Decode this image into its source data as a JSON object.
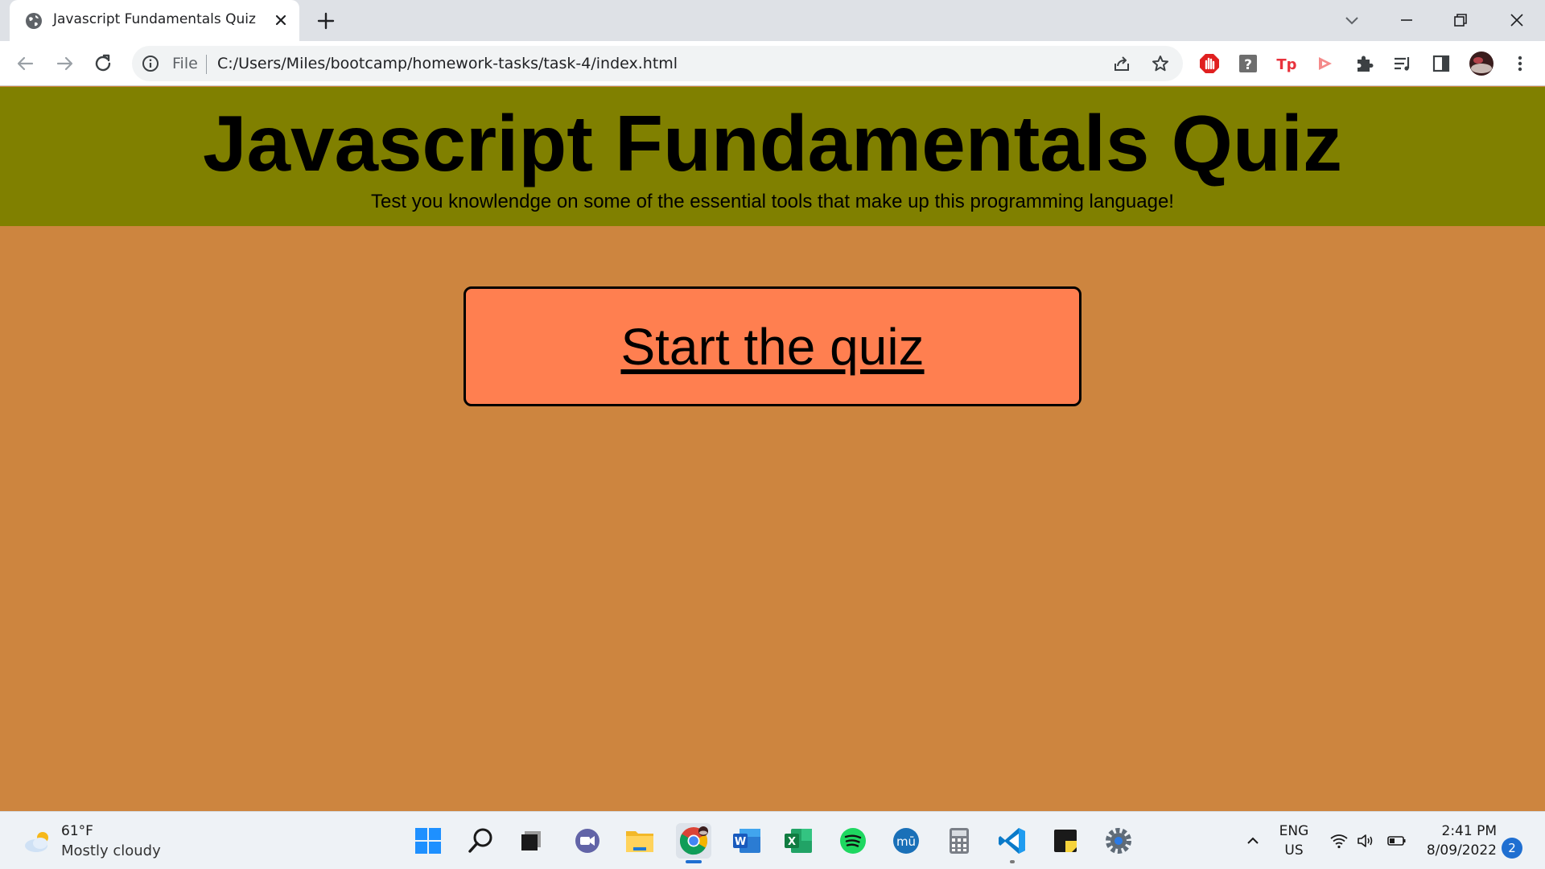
{
  "browser": {
    "tab": {
      "title": "Javascript Fundamentals Quiz",
      "favicon": "globe-icon"
    },
    "omnibox": {
      "scheme_label": "File",
      "url": "C:/Users/Miles/bootcamp/homework-tasks/task-4/index.html"
    },
    "extensions": [
      "adblock-icon",
      "help-icon",
      "tp-extension-icon",
      "video-extension-icon",
      "puzzle-icon",
      "reading-list-icon",
      "side-panel-icon",
      "profile-avatar"
    ],
    "colors": {
      "tabstrip": "#dee1e6",
      "toolbar": "#ffffff",
      "omnibox": "#f1f3f4"
    }
  },
  "page": {
    "title": "Javascript Fundamentals Quiz",
    "subtitle": "Test you knowlendge on some of the essential tools that make up this programming language!",
    "start_button_label": "Start the quiz",
    "colors": {
      "background": "#cd853f",
      "header": "#808000",
      "button": "#ff7f50",
      "text": "#000000"
    }
  },
  "taskbar": {
    "weather": {
      "temp": "61°F",
      "desc": "Mostly cloudy"
    },
    "apps": [
      "start-icon",
      "search-icon",
      "task-view-icon",
      "teams-chat-icon",
      "file-explorer-icon",
      "chrome-icon",
      "word-icon",
      "excel-icon",
      "spotify-icon",
      "musescore-icon",
      "calculator-icon",
      "vscode-icon",
      "sticky-notes-icon",
      "settings-icon"
    ],
    "tray": {
      "lang_top": "ENG",
      "lang_bottom": "US",
      "time": "2:41 PM",
      "date": "8/09/2022",
      "notifications": "2"
    }
  }
}
